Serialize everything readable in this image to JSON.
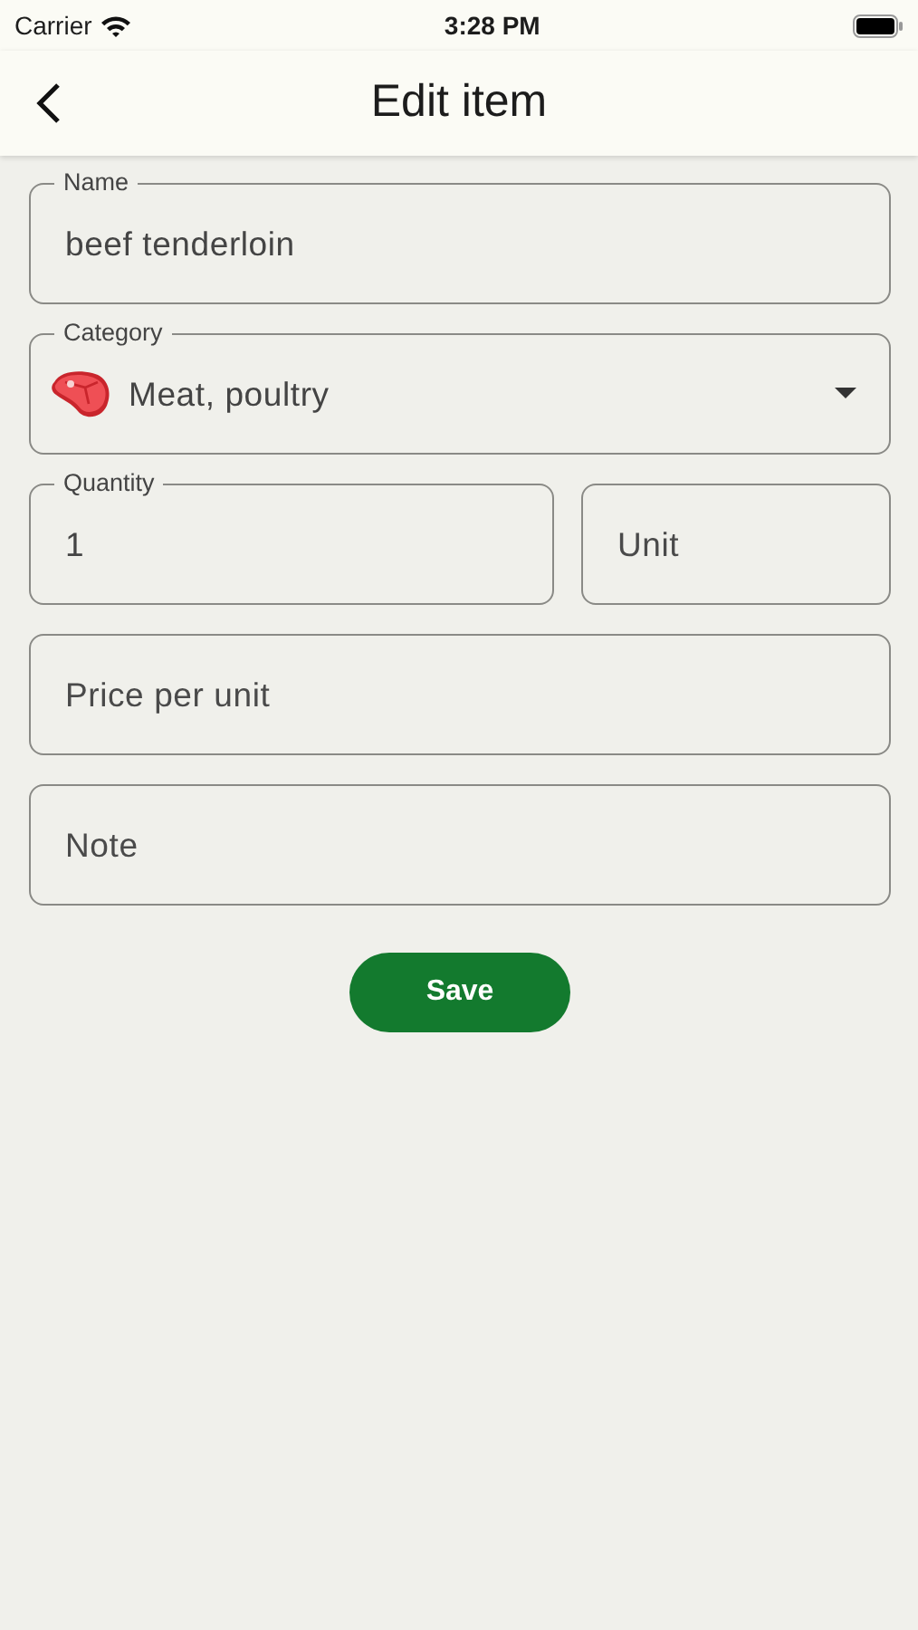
{
  "status_bar": {
    "carrier": "Carrier",
    "time": "3:28 PM"
  },
  "header": {
    "title": "Edit item"
  },
  "form": {
    "rows": [
      [
        {
          "kind": "text",
          "label": "Name",
          "value": "beef tenderloin"
        }
      ],
      [
        {
          "kind": "select",
          "label": "Category",
          "value": "Meat, poultry"
        }
      ],
      [
        {
          "kind": "text",
          "label": "Quantity",
          "value": "1"
        },
        {
          "kind": "text",
          "placeholder": "Unit"
        }
      ],
      [
        {
          "kind": "text",
          "placeholder": "Price per unit"
        }
      ],
      [
        {
          "kind": "text",
          "placeholder": "Note"
        }
      ]
    ],
    "save_button": "Save"
  }
}
